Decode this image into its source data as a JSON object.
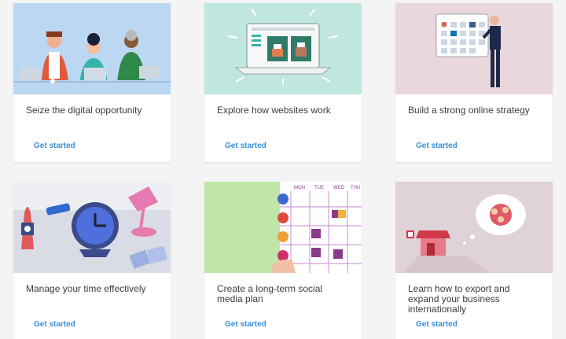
{
  "cards": [
    {
      "title": "Seize the digital opportunity",
      "cta": "Get started",
      "bg": "#bcd7f2"
    },
    {
      "title": "Explore how websites work",
      "cta": "Get started",
      "bg": "#bfe6df"
    },
    {
      "title": "Build a strong online strategy",
      "cta": "Get started",
      "bg": "#e9d7dc"
    },
    {
      "title": "Manage your time effectively",
      "cta": "Get started",
      "bg": "#d9dce4"
    },
    {
      "title": "Create a long-term social media plan",
      "cta": "Get started",
      "bg": "#ffffff"
    },
    {
      "title": "Learn how to export and expand your business internationally",
      "cta": "Get started",
      "bg": "#dfd2d9"
    }
  ],
  "calendar": {
    "days": [
      "MON",
      "TUE",
      "WED",
      "THU"
    ]
  },
  "accent": "#3a8fd8",
  "icons": [
    "people-illustration",
    "laptop-cake-illustration",
    "calendar-man-illustration",
    "desk-clock-illustration",
    "social-calendar-illustration",
    "export-shop-illustration"
  ]
}
